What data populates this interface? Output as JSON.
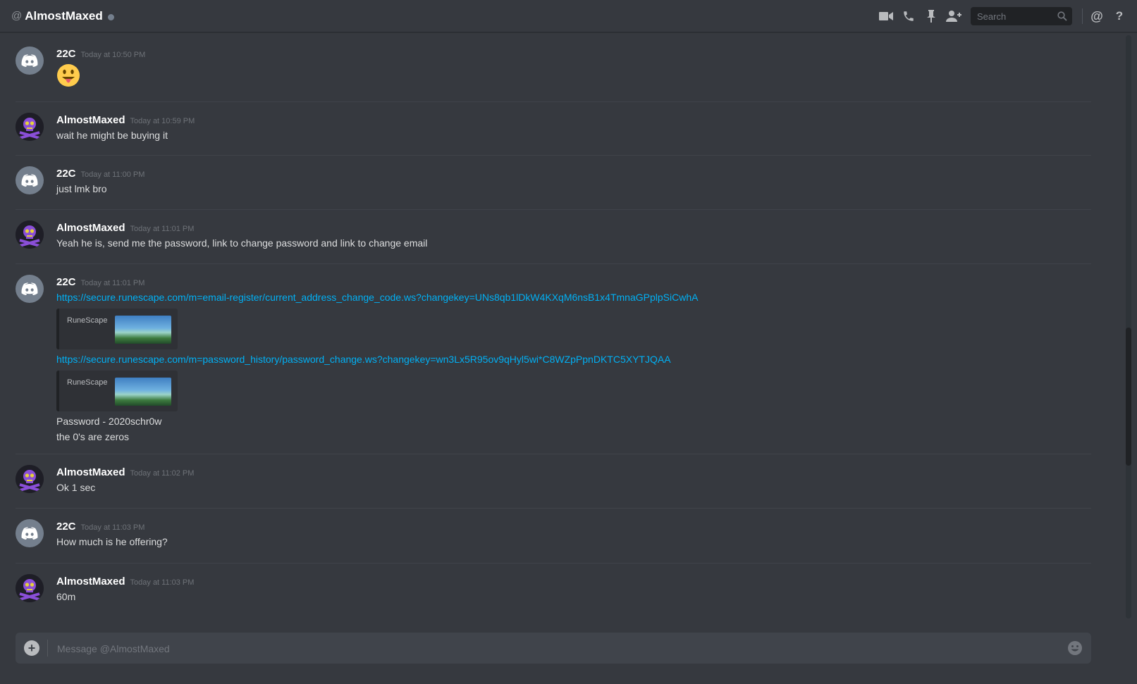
{
  "header": {
    "at_symbol": "@",
    "title": "AlmostMaxed",
    "search_placeholder": "Search",
    "icons": [
      "video-call-icon",
      "voice-call-icon",
      "pin-icon",
      "add-friend-icon",
      "search-icon",
      "mentions-icon",
      "help-icon"
    ],
    "mentions_glyph": "@",
    "help_glyph": "?"
  },
  "colors": {
    "background": "#36393f",
    "link": "#00b0f4",
    "username": "#ffffff",
    "timestamp": "#6e7278",
    "discord_avatar": "#747f8d"
  },
  "messages": [
    {
      "author": "22C",
      "time": "Today at 10:50 PM",
      "emoji": "stuck-out-tongue-emoji"
    },
    {
      "author": "AlmostMaxed",
      "time": "Today at 10:59 PM",
      "lines": [
        "wait he might be buying it"
      ]
    },
    {
      "author": "22C",
      "time": "Today at 11:00 PM",
      "lines": [
        "just lmk bro"
      ]
    },
    {
      "author": "AlmostMaxed",
      "time": "Today at 11:01 PM",
      "lines": [
        "Yeah he is, send me the password, link to change password and link to change email"
      ]
    },
    {
      "author": "22C",
      "time": "Today at 11:01 PM",
      "link1": "https://secure.runescape.com/m=email-register/current_address_change_code.ws?changekey=UNs8qb1lDkW4KXqM6nsB1x4TmnaGPplpSiCwhA",
      "embed1_provider": "RuneScape",
      "link2": "https://secure.runescape.com/m=password_history/password_change.ws?changekey=wn3Lx5R95ov9qHyl5wi*C8WZpPpnDKTC5XYTJQAA",
      "embed2_provider": "RuneScape",
      "line3": "Password - 2020schr0w",
      "line4": "the 0's are zeros"
    },
    {
      "author": "AlmostMaxed",
      "time": "Today at 11:02 PM",
      "lines": [
        "Ok 1 sec"
      ]
    },
    {
      "author": "22C",
      "time": "Today at 11:03 PM",
      "lines": [
        "How much is he offering?"
      ]
    },
    {
      "author": "AlmostMaxed",
      "time": "Today at 11:03 PM",
      "lines": [
        "60m"
      ]
    }
  ],
  "composer": {
    "placeholder": "Message @AlmostMaxed",
    "attach_glyph": "+"
  }
}
